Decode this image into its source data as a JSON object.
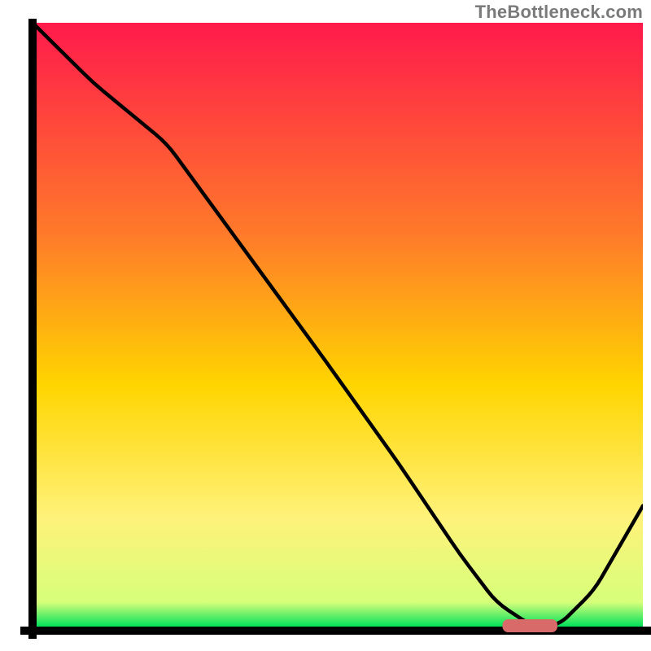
{
  "attribution": "TheBottleneck.com",
  "colors": {
    "gradient_top": "#ff1a4b",
    "gradient_mid1": "#ff7a2a",
    "gradient_mid2": "#ffd500",
    "gradient_low": "#fff27a",
    "gradient_bottom": "#00e05a",
    "stroke": "#000000",
    "axis": "#000000",
    "marker": "#d96a6a"
  },
  "chart_data": {
    "type": "line",
    "title": "",
    "xlabel": "",
    "ylabel": "",
    "xlim": [
      0,
      100
    ],
    "ylim": [
      0,
      100
    ],
    "grid": false,
    "series": [
      {
        "name": "curve",
        "x": [
          0,
          10,
          22,
          35,
          48,
          60,
          70,
          76,
          82,
          86,
          92,
          100
        ],
        "y": [
          100,
          90,
          80,
          62,
          44,
          27,
          12,
          4,
          0,
          0,
          6,
          20
        ]
      }
    ],
    "marker": {
      "name": "optimal-range",
      "x_start": 77,
      "x_end": 86,
      "y": 0
    }
  }
}
